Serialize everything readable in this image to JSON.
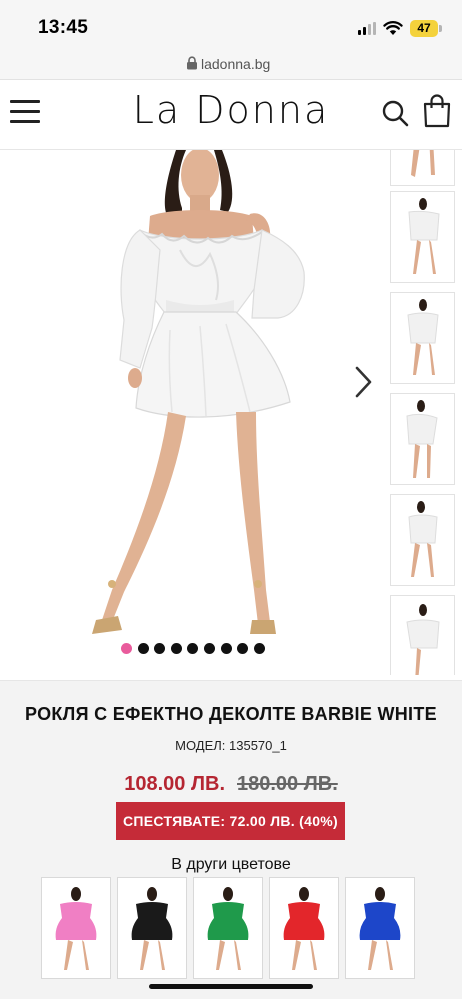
{
  "status_bar": {
    "time": "13:45",
    "battery": "47"
  },
  "browser": {
    "url": "ladonna.bg"
  },
  "header": {
    "logo": "La Donna",
    "icons": [
      "menu-icon",
      "search-icon",
      "shopping-bag-icon"
    ]
  },
  "gallery": {
    "slide_count": 9,
    "active_slide": 1,
    "thumbnail_count": 6,
    "dress_color": "#ffffff",
    "accent_dot_color": "#e95b9c"
  },
  "product": {
    "title": "РОКЛЯ С ЕФЕКТНО ДЕКОЛТЕ BARBIE WHITE",
    "model": "МОДЕЛ: 135570_1",
    "price_new": "108.00 ЛВ.",
    "price_old": "180.00 ЛВ.",
    "savings": "СПЕСТЯВАТЕ: 72.00 ЛВ. (40%)",
    "price_color": "#b52632",
    "badge_color": "#c52b38"
  },
  "other_colors": {
    "label": "В други цветове",
    "items": [
      {
        "name": "pink",
        "color": "#f07fc4"
      },
      {
        "name": "black",
        "color": "#1a1a1a"
      },
      {
        "name": "green",
        "color": "#1f9a4b"
      },
      {
        "name": "red",
        "color": "#e3262b"
      },
      {
        "name": "blue",
        "color": "#1d46c9"
      }
    ]
  }
}
